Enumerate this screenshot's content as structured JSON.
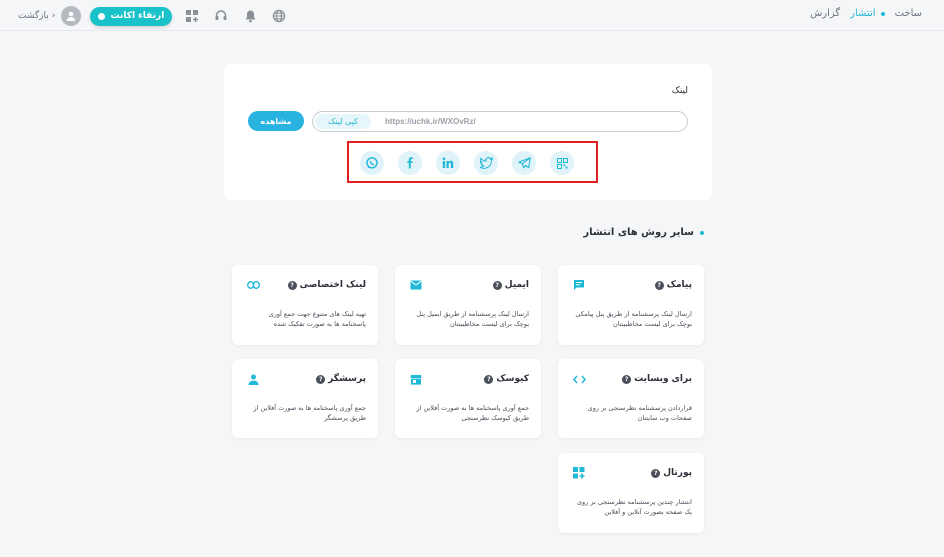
{
  "topbar": {
    "nav": [
      "ساخت",
      "انتشار",
      "گزارش"
    ],
    "back_label": "بازگشت",
    "upgrade_label": "ارتقاء اکانت",
    "icons": [
      "globe-icon",
      "bell-icon",
      "support-icon",
      "apps-add-icon"
    ]
  },
  "link_card": {
    "title": "لینک",
    "url": "https://uchk.ir/WXOvRz/",
    "copy_label": "کپی لینک",
    "view_label": "مشاهده",
    "share_icons": [
      "qr-code-icon",
      "telegram-icon",
      "twitter-icon",
      "linkedin-icon",
      "facebook-icon",
      "whatsapp-icon"
    ]
  },
  "section": {
    "title": "سایر روش های انتشار"
  },
  "methods": [
    {
      "title": "پیامک",
      "desc": "ارسال لینک پرسشنامه از طریق پنل پیامکی بوچک برای لیست مخاطبینتان",
      "icon": "sms-icon"
    },
    {
      "title": "ایمیل",
      "desc": "ارسال لینک پرسشنامه از طریق ایمیل پنل بوچک برای لیست مخاطبینتان",
      "icon": "email-icon"
    },
    {
      "title": "لینک اختصاصی",
      "desc": "تهیه لینک های متنوع جهت جمع آوری پاسخنامه ها به صورت تفکیک شده",
      "icon": "link-icon"
    },
    {
      "title": "برای وبسایت",
      "desc": "قراردادن پرسشنامه نظرسنجی بر روی صفحات وب سایتتان",
      "icon": "code-icon"
    },
    {
      "title": "کیوسک",
      "desc": "جمع آوری پاسخنامه ها به صورت آفلاین از طریق کیوسک نظرسنجی",
      "icon": "kiosk-icon"
    },
    {
      "title": "پرسشگر",
      "desc": "جمع آوری پاسخنامه ها به صورت آفلاین از طریق پرسشگر",
      "icon": "person-icon"
    },
    {
      "title": "پورتال",
      "desc": "انتشار چندین پرسشنامه نظرسنجی بر روی یک صفحه بصورت آنلاین و آفلاین",
      "icon": "portal-icon"
    }
  ],
  "colors": {
    "accent": "#1fb8d6",
    "upgrade": "#19c1c9",
    "highlight_border": "#e02020"
  }
}
